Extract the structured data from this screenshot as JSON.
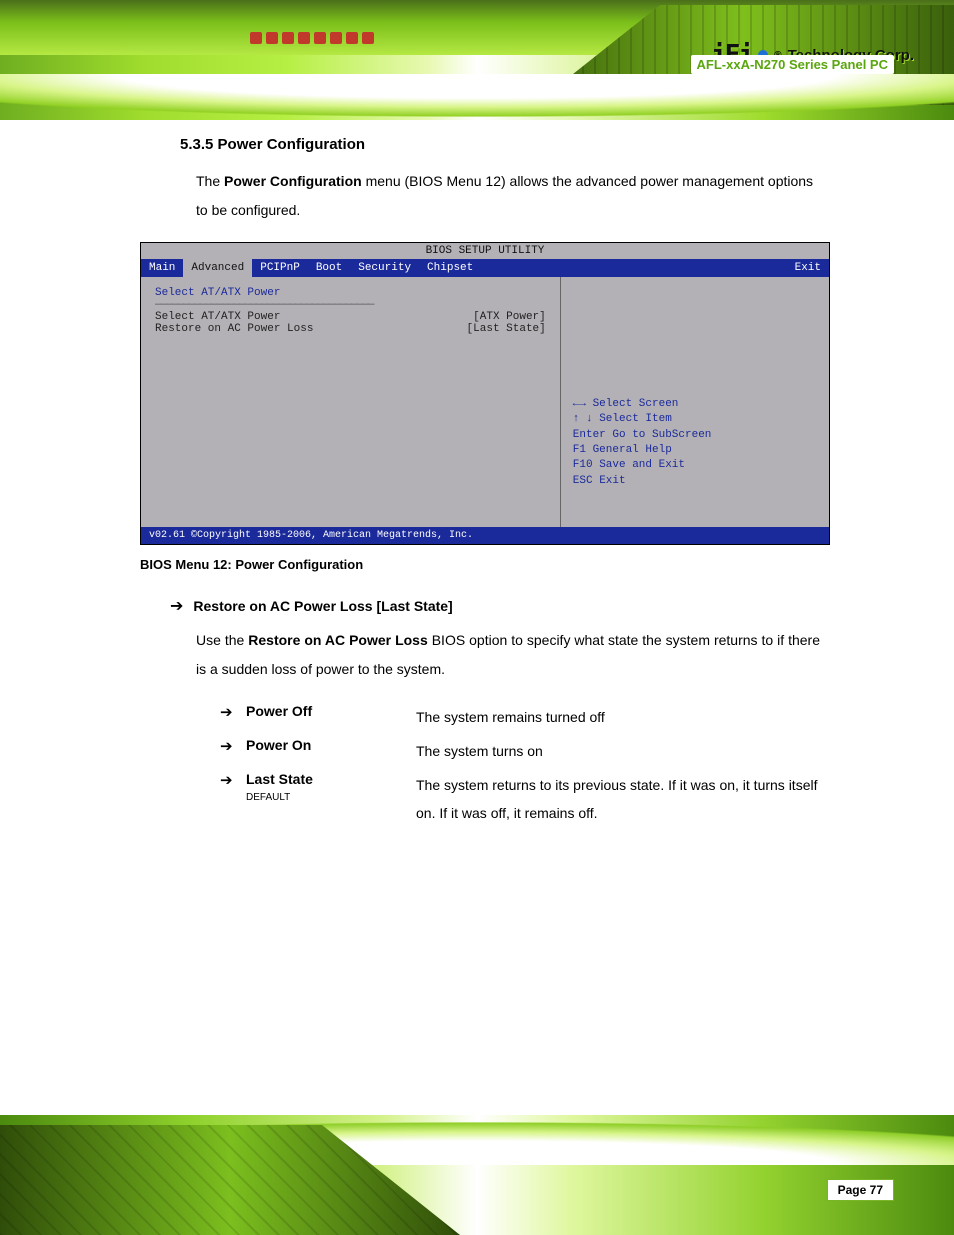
{
  "header": {
    "product": "AFL-xxA-N270 Series Panel PC",
    "logo_text": "Technology Corp.",
    "logo_mark": "iEi"
  },
  "section": {
    "title": "5.3.5 Power Configuration",
    "intro_pre": "The ",
    "intro_bold": "Power Configuration",
    "intro_post": " menu (BIOS Menu 12) allows the advanced power management options to be configured."
  },
  "bios": {
    "util_title": "BIOS SETUP UTILITY",
    "tabs": [
      "Main",
      "Advanced",
      "PCIPnP",
      "Boot",
      "Security",
      "Chipset",
      "Exit"
    ],
    "selected_tab": 1,
    "left_heading": "Select AT/ATX Power",
    "rows": [
      {
        "k": "Select AT/ATX Power",
        "v": "[ATX Power]"
      },
      {
        "k": "Restore on AC Power Loss",
        "v": "[Last State]"
      }
    ],
    "right_hint": "",
    "keys": [
      {
        "sym": "←→",
        "txt": "Select Screen"
      },
      {
        "sym": "↑ ↓",
        "txt": "Select Item"
      },
      {
        "sym": "Enter",
        "txt": "Go to SubScreen"
      },
      {
        "sym": "F1",
        "txt": "General Help"
      },
      {
        "sym": "F10",
        "txt": "Save and Exit"
      },
      {
        "sym": "ESC",
        "txt": "Exit"
      }
    ],
    "footer": "v02.61 ©Copyright 1985-2006, American Megatrends, Inc."
  },
  "caption": "BIOS Menu 12: Power Configuration",
  "option": {
    "arrow": "➔",
    "heading": "Restore on AC Power Loss [Last State]",
    "para_pre": "Use the ",
    "para_bold": "Restore on AC Power Loss",
    "para_post": " BIOS option to specify what state the system returns to if there is a sudden loss of power to the system.",
    "rows": [
      {
        "name": "Power Off",
        "default": "",
        "desc": "The system remains turned off"
      },
      {
        "name": "Power On",
        "default": "",
        "desc": "The system turns on"
      },
      {
        "name": "Last State",
        "default": "DEFAULT",
        "desc": "The system returns to its previous state. If it was on, it turns itself on. If it was off, it remains off."
      }
    ]
  },
  "footer": {
    "page_label": "Page 77"
  }
}
